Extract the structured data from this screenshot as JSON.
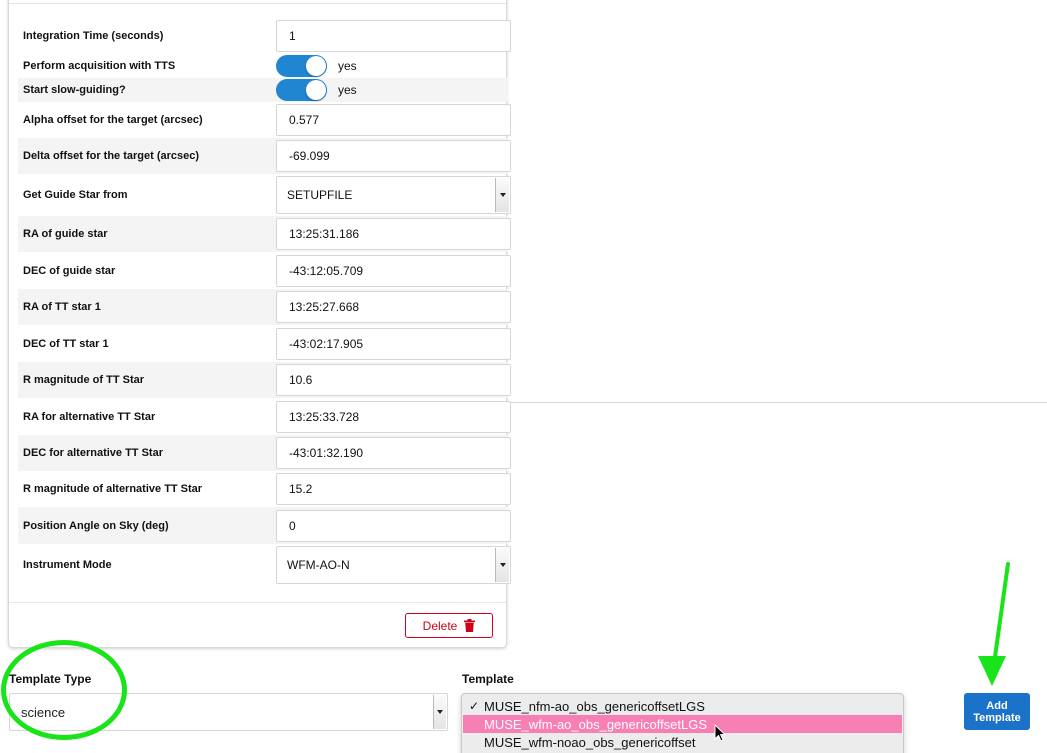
{
  "form": {
    "rows": [
      {
        "label": "Integration Time (seconds)",
        "type": "input",
        "value": "1"
      },
      {
        "label": "Perform acquisition with TTS",
        "type": "toggle",
        "value": "yes"
      },
      {
        "label": "Start slow-guiding?",
        "type": "toggle",
        "value": "yes"
      },
      {
        "label": "Alpha offset for the target (arcsec)",
        "type": "input",
        "value": "0.577"
      },
      {
        "label": "Delta offset for the target (arcsec)",
        "type": "input",
        "value": "-69.099"
      },
      {
        "label": "Get Guide Star from",
        "type": "select",
        "value": "SETUPFILE"
      },
      {
        "label": "RA of guide star",
        "type": "input",
        "value": "13:25:31.186"
      },
      {
        "label": "DEC of guide star",
        "type": "input",
        "value": "-43:12:05.709"
      },
      {
        "label": "RA of TT star 1",
        "type": "input",
        "value": "13:25:27.668"
      },
      {
        "label": "DEC of TT star 1",
        "type": "input",
        "value": "-43:02:17.905"
      },
      {
        "label": "R magnitude of TT Star",
        "type": "input",
        "value": "10.6"
      },
      {
        "label": "RA for alternative TT Star",
        "type": "input",
        "value": "13:25:33.728"
      },
      {
        "label": "DEC for alternative TT Star",
        "type": "input",
        "value": "-43:01:32.190"
      },
      {
        "label": "R magnitude of alternative TT Star",
        "type": "input",
        "value": "15.2"
      },
      {
        "label": "Position Angle on Sky (deg)",
        "type": "input",
        "value": "0"
      },
      {
        "label": "Instrument Mode",
        "type": "select",
        "value": "WFM-AO-N"
      }
    ],
    "delete_label": "Delete"
  },
  "template_type": {
    "label": "Template Type",
    "value": "science"
  },
  "template": {
    "label": "Template",
    "check_glyph": "✓",
    "options": [
      {
        "label": "MUSE_nfm-ao_obs_genericoffsetLGS",
        "checked": true,
        "highlighted": false
      },
      {
        "label": "MUSE_wfm-ao_obs_genericoffsetLGS",
        "checked": false,
        "highlighted": true
      },
      {
        "label": "MUSE_wfm-noao_obs_genericoffset",
        "checked": false,
        "highlighted": false
      }
    ]
  },
  "add_template": {
    "line1": "Add",
    "line2": "Template"
  },
  "colors": {
    "toggle_on": "#2186d2",
    "delete": "#d0021b",
    "highlight": "#f77fb4",
    "add_button": "#1a73c8",
    "annotation": "#19e319"
  }
}
